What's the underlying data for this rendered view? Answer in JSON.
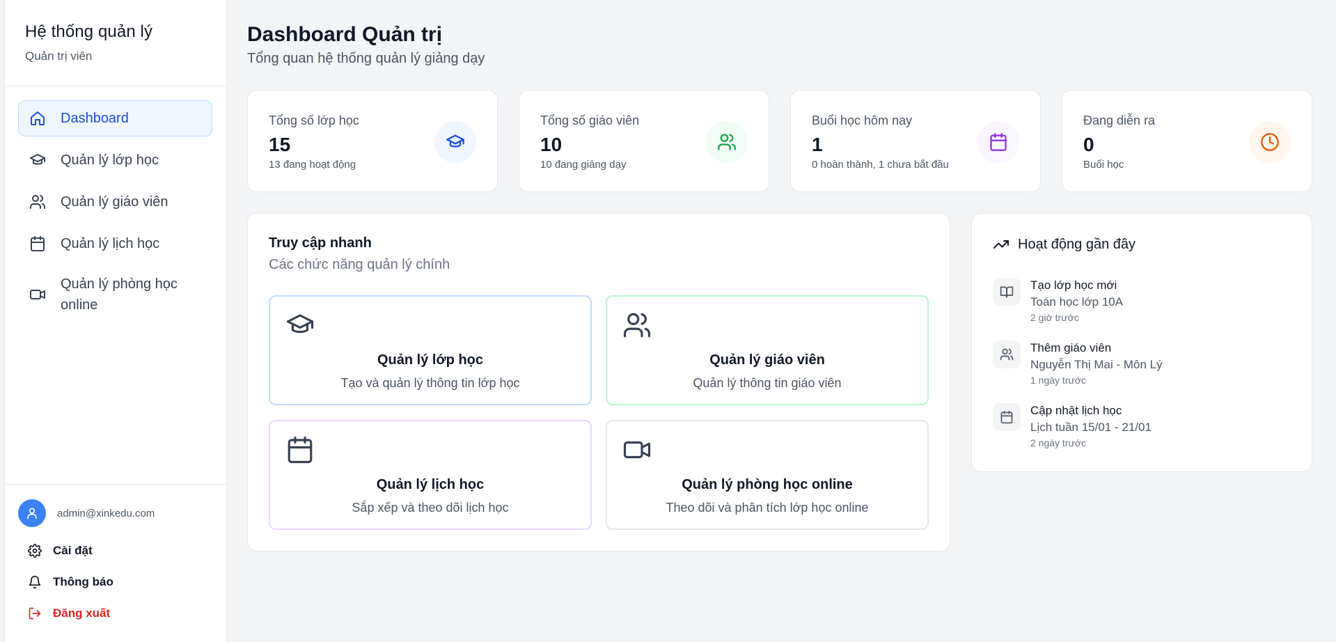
{
  "sidebar": {
    "title": "Hệ thống quản lý",
    "subtitle": "Quản trị viên",
    "items": [
      {
        "label": "Dashboard",
        "icon": "home-icon",
        "active": true
      },
      {
        "label": "Quản lý lớp học",
        "icon": "graduation-cap-icon"
      },
      {
        "label": "Quản lý giáo viên",
        "icon": "users-icon"
      },
      {
        "label": "Quản lý lịch học",
        "icon": "calendar-icon"
      },
      {
        "label": "Quản lý phòng học online",
        "icon": "video-icon"
      }
    ],
    "user": {
      "email": "admin@xinkedu.com",
      "avatar_icon": "user-icon"
    },
    "settings_label": "Cài đặt",
    "notifications_label": "Thông báo",
    "logout_label": "Đăng xuất"
  },
  "header": {
    "title": "Dashboard Quản trị",
    "subtitle": "Tổng quan hệ thống quản lý giảng dạy"
  },
  "stats": [
    {
      "label": "Tổng số lớp học",
      "value": "15",
      "note": "13 đang hoạt động",
      "icon": "graduation-cap-icon",
      "color": "#1d4ed8",
      "bg": "#eff6ff"
    },
    {
      "label": "Tổng số giáo viên",
      "value": "10",
      "note": "10 đang giảng dạy",
      "icon": "users-icon",
      "color": "#16a34a",
      "bg": "#f0fdf4"
    },
    {
      "label": "Buổi học hôm nay",
      "value": "1",
      "note": "0 hoàn thành, 1 chưa bắt đầu",
      "icon": "calendar-icon",
      "color": "#9333ea",
      "bg": "#faf5ff"
    },
    {
      "label": "Đang diễn ra",
      "value": "0",
      "note": "Buổi học",
      "icon": "clock-icon",
      "color": "#ea580c",
      "bg": "#fff7ed"
    }
  ],
  "quick_access": {
    "title": "Truy cập nhanh",
    "subtitle": "Các chức năng quản lý chính",
    "tiles": [
      {
        "title": "Quản lý lớp học",
        "desc": "Tạo và quản lý thông tin lớp học",
        "icon": "graduation-cap-icon",
        "border": "#bfdbfe"
      },
      {
        "title": "Quản lý giáo viên",
        "desc": "Quản lý thông tin giáo viên",
        "icon": "users-icon",
        "border": "#bbf7d0"
      },
      {
        "title": "Quản lý lịch học",
        "desc": "Sắp xếp và theo dõi lịch học",
        "icon": "calendar-icon",
        "border": "#e9d5ff"
      },
      {
        "title": "Quản lý phòng học online",
        "desc": "Theo dõi và phân tích lớp học online",
        "icon": "video-icon",
        "border": "#e5e7eb"
      }
    ]
  },
  "activity": {
    "title": "Hoạt động gần đây",
    "items": [
      {
        "title": "Tạo lớp học mới",
        "detail": "Toán học lớp 10A",
        "time": "2 giờ trước",
        "icon": "book-icon"
      },
      {
        "title": "Thêm giáo viên",
        "detail": "Nguyễn Thị Mai - Môn Lý",
        "time": "1 ngày trước",
        "icon": "users-icon"
      },
      {
        "title": "Cập nhật lịch học",
        "detail": "Lịch tuần 15/01 - 21/01",
        "time": "2 ngày trước",
        "icon": "calendar-icon"
      }
    ]
  }
}
